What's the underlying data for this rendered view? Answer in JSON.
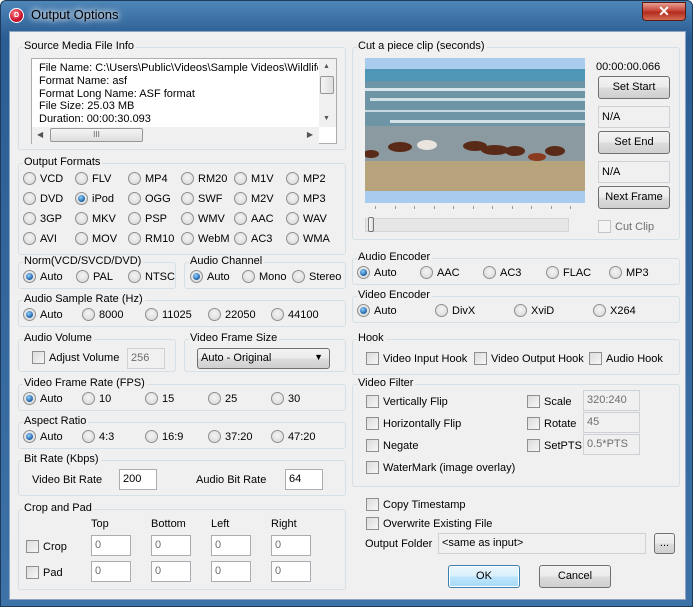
{
  "window": {
    "title": "Output Options",
    "app_icon": "D",
    "close_glyph": "✕"
  },
  "source_info": {
    "legend": "Source Media File Info",
    "lines": [
      "File Name: C:\\Users\\Public\\Videos\\Sample Videos\\Wildlife",
      "Format Name: asf",
      "Format Long Name: ASF format",
      "File Size: 25.03 MB",
      "Duration: 00:00:30.093"
    ]
  },
  "output_formats": {
    "legend": "Output Formats",
    "selected": "iPod",
    "rows": [
      [
        "VCD",
        "FLV",
        "MP4",
        "RM20",
        "M1V",
        "MP2"
      ],
      [
        "DVD",
        "iPod",
        "OGG",
        "SWF",
        "M2V",
        "MP3"
      ],
      [
        "3GP",
        "MKV",
        "PSP",
        "WMV",
        "AAC",
        "WAV"
      ],
      [
        "AVI",
        "MOV",
        "RM10",
        "WebM",
        "AC3",
        "WMA"
      ]
    ]
  },
  "norm": {
    "legend": "Norm(VCD/SVCD/DVD)",
    "options": [
      "Auto",
      "PAL",
      "NTSC"
    ],
    "selected": "Auto"
  },
  "audio_channel": {
    "legend": "Audio Channel",
    "options": [
      "Auto",
      "Mono",
      "Stereo"
    ],
    "selected": "Auto"
  },
  "sample_rate": {
    "legend": "Audio Sample Rate (Hz)",
    "options": [
      "Auto",
      "8000",
      "11025",
      "22050",
      "44100"
    ],
    "selected": "Auto"
  },
  "audio_volume": {
    "legend": "Audio Volume",
    "checkbox_label": "Adjust Volume",
    "checked": false,
    "value": "256"
  },
  "frame_size": {
    "legend": "Video Frame Size",
    "selected": "Auto - Original"
  },
  "frame_rate": {
    "legend": "Video Frame Rate (FPS)",
    "options": [
      "Auto",
      "10",
      "15",
      "25",
      "30"
    ],
    "selected": "Auto"
  },
  "aspect_ratio": {
    "legend": "Aspect Ratio",
    "options": [
      "Auto",
      "4:3",
      "16:9",
      "37:20",
      "47:20"
    ],
    "selected": "Auto"
  },
  "bit_rate": {
    "legend": "Bit Rate (Kbps)",
    "video_label": "Video Bit Rate",
    "video_value": "200",
    "audio_label": "Audio Bit Rate",
    "audio_value": "64"
  },
  "crop_pad": {
    "legend": "Crop and Pad",
    "columns": [
      "Top",
      "Bottom",
      "Left",
      "Right"
    ],
    "rows": [
      {
        "label": "Crop",
        "checked": false,
        "values": [
          "0",
          "0",
          "0",
          "0"
        ]
      },
      {
        "label": "Pad",
        "checked": false,
        "values": [
          "0",
          "0",
          "0",
          "0"
        ]
      }
    ]
  },
  "clip": {
    "legend": "Cut a piece clip (seconds)",
    "time": "00:00:00.066",
    "set_start": "Set Start",
    "start_value": "N/A",
    "set_end": "Set End",
    "end_value": "N/A",
    "next_frame": "Next Frame",
    "cut_clip": "Cut Clip",
    "slider_position": 0.0
  },
  "audio_encoder": {
    "legend": "Audio Encoder",
    "options": [
      "Auto",
      "AAC",
      "AC3",
      "FLAC",
      "MP3"
    ],
    "selected": "Auto"
  },
  "video_encoder": {
    "legend": "Video Encoder",
    "options": [
      "Auto",
      "DivX",
      "XviD",
      "X264"
    ],
    "selected": "Auto"
  },
  "hook": {
    "legend": "Hook",
    "options": [
      "Video Input Hook",
      "Video Output Hook",
      "Audio Hook"
    ]
  },
  "video_filter": {
    "legend": "Video Filter",
    "left": [
      "Vertically Flip",
      "Horizontally Flip",
      "Negate",
      "WaterMark (image overlay)"
    ],
    "right": [
      {
        "label": "Scale",
        "value": "320:240"
      },
      {
        "label": "Rotate",
        "value": "45"
      },
      {
        "label": "SetPTS",
        "value": "0.5*PTS"
      }
    ]
  },
  "misc": {
    "copy_timestamp": "Copy Timestamp",
    "overwrite": "Overwrite Existing File",
    "output_folder_label": "Output Folder",
    "output_folder_value": "<same as input>",
    "browse": "...",
    "ok": "OK",
    "cancel": "Cancel"
  }
}
